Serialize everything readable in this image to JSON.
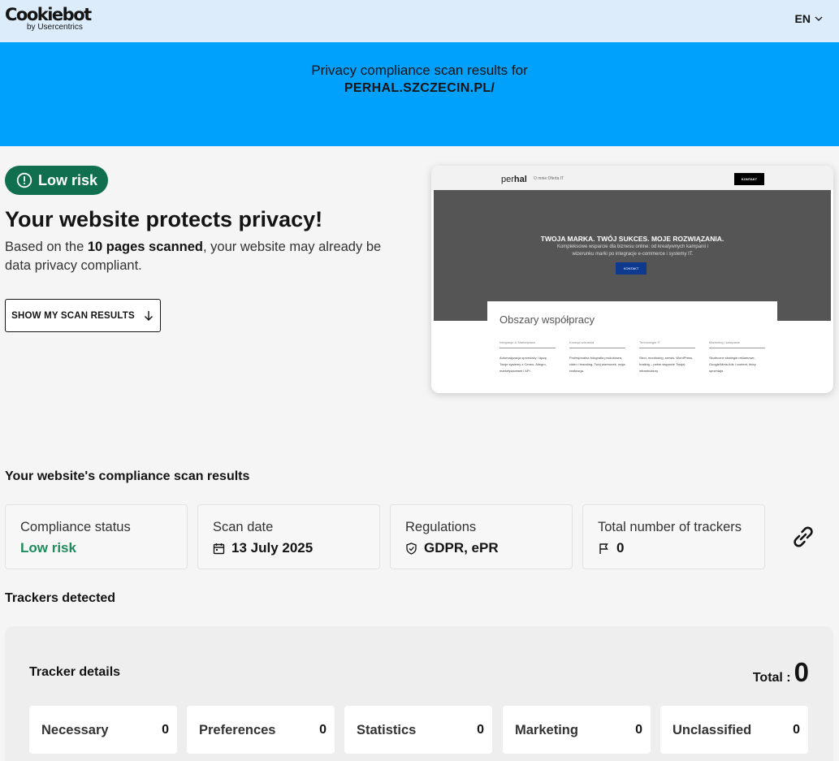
{
  "header": {
    "logo_main": "Cookiebot",
    "logo_sub": "by Usercentrics",
    "language": "EN"
  },
  "hero": {
    "intro": "Privacy compliance scan results for",
    "domain": "PERHAL.SZCZECIN.PL/"
  },
  "result": {
    "risk_label": "Low risk",
    "headline": "Your website protects privacy!",
    "desc_prefix": "Based on the ",
    "desc_bold": "10 pages scanned",
    "desc_suffix": ", your website may already be data privacy compliant.",
    "button_label": "SHOW MY SCAN RESULTS"
  },
  "preview": {
    "logo_a": "per",
    "logo_b": "hal",
    "nav_links": "O mnie    Oferta IT",
    "nav_button": "KONTAKT",
    "title": "TWOJA MARKA. TWÓJ SUKCES. MOJE ROZWIĄZANIA.",
    "subtitle": "Kompleksowe wsparcie dla biznesu online: od kreatywnych kampanii i wizerunku marki po integracje e-commerce i systemy IT.",
    "cta": "KONTAKT",
    "section_title": "Obszary współpracy",
    "columns": [
      {
        "heading": "Integracje & Marketplace",
        "text": "Automatyzacja sprzedaży i łączę Twoje systemy z Ceneo, Allegro, marketplaceami i API."
      },
      {
        "heading": "Kreacja wizualna",
        "text": "Profesjonalna fotografia produktowa, video i branding. Twój wizerunek, moja realizacja."
      },
      {
        "heading": "Technologie IT",
        "text": "Sieci, monitoring, serwis, WordPress, hosting – pełne wsparcie Twojej infrastruktury."
      },
      {
        "heading": "Marketing i kampanie",
        "text": "Skuteczne strategie reklamowe, Google/Meta Ads i content, który sprzedaje."
      }
    ]
  },
  "compliance": {
    "section_title": "Your website's compliance scan results",
    "cards": [
      {
        "label": "Compliance status",
        "value": "Low risk"
      },
      {
        "label": "Scan date",
        "value": "13 July 2025"
      },
      {
        "label": "Regulations",
        "value": "GDPR, ePR"
      },
      {
        "label": "Total number of trackers",
        "value": "0"
      }
    ]
  },
  "trackers": {
    "section_title": "Trackers detected",
    "panel_title": "Tracker details",
    "total_label": "Total :",
    "total_value": "0",
    "categories": [
      {
        "name": "Necessary",
        "count": "0"
      },
      {
        "name": "Preferences",
        "count": "0"
      },
      {
        "name": "Statistics",
        "count": "0"
      },
      {
        "name": "Marketing",
        "count": "0"
      },
      {
        "name": "Unclassified",
        "count": "0"
      }
    ]
  },
  "colors": {
    "header_bg": "#dcecfb",
    "hero_bg": "#00a0fd",
    "risk_green": "#0f6f4f",
    "status_green": "#1f8b5c"
  },
  "icons": {
    "risk": "exclamation-circle-icon",
    "scan_arrow": "arrow-down-icon",
    "date": "calendar-icon",
    "regulations": "shield-check-icon",
    "trackers": "flag-icon",
    "share": "link-icon",
    "language": "chevron-down-icon"
  }
}
